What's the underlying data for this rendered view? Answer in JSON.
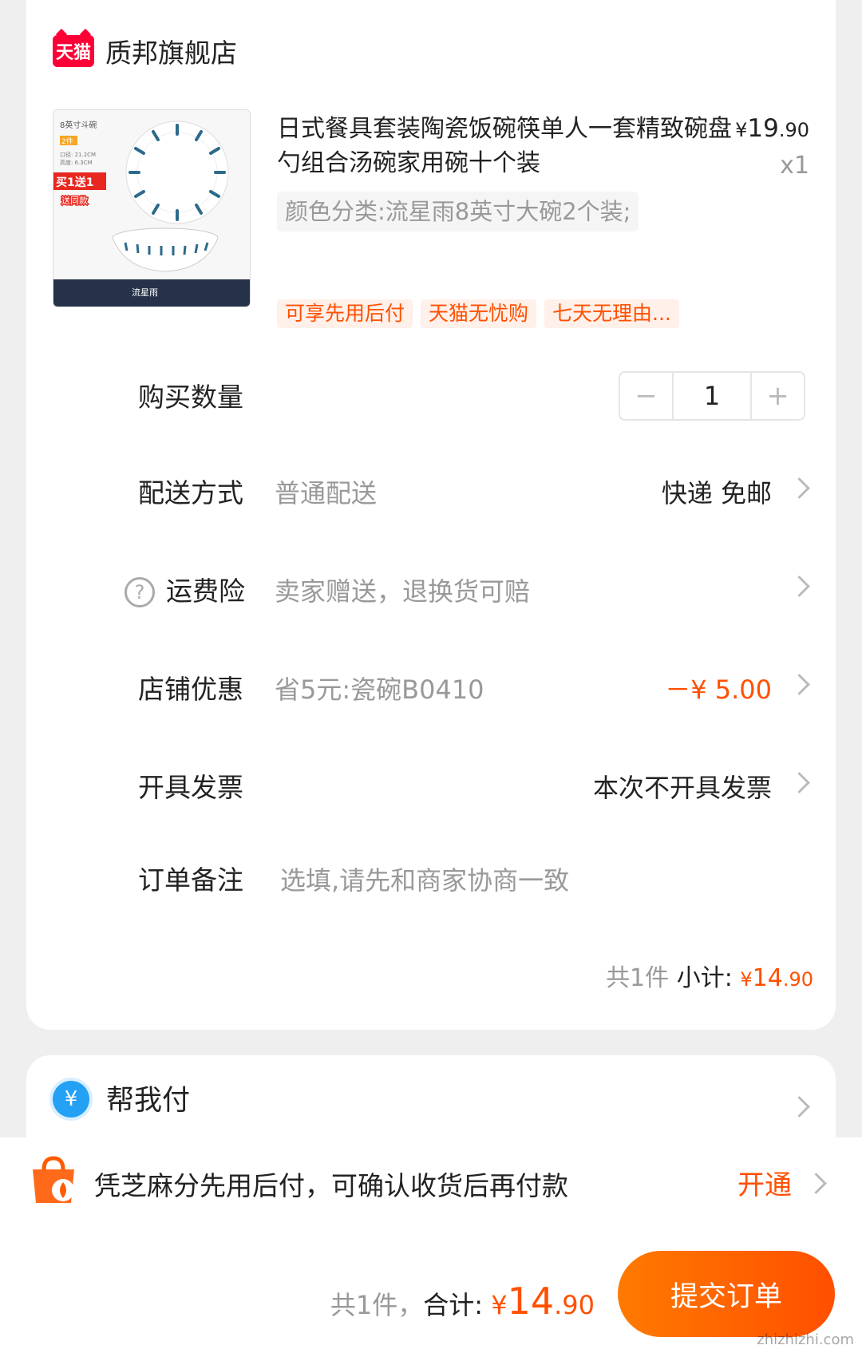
{
  "shop": {
    "name": "质邦旗舰店",
    "logo_text": "天猫"
  },
  "product": {
    "title": "日式餐具套装陶瓷饭碗筷单人一套精致碗盘勺组合汤碗家用碗十个装",
    "price_currency": "¥",
    "price_int": "19",
    "price_dec": ".90",
    "quantity": "x1",
    "sku": "颜色分类:流星雨8英寸大碗2个装;",
    "image": {
      "size_label": "8英寸斗碗",
      "pieces": "2件",
      "spec1": "口径: 21.2CM",
      "spec2": "高度: 6.3CM",
      "promo": "买1送1",
      "promo_sub": "送同款",
      "pattern_name": "流星雨"
    },
    "tags": [
      "可享先用后付",
      "天猫无忧购",
      "七天无理由..."
    ]
  },
  "rows": {
    "quantity": {
      "label": "购买数量",
      "minus": "−",
      "value": "1",
      "plus": "+"
    },
    "delivery": {
      "label": "配送方式",
      "value": "普通配送",
      "right": "快递 免邮"
    },
    "shipping_insurance": {
      "label": "运费险",
      "value": "卖家赠送，退换货可赔",
      "help_icon": "?"
    },
    "shop_discount": {
      "label": "店铺优惠",
      "value": "省5元:瓷碗B0410",
      "right": "－¥ 5.00"
    },
    "invoice": {
      "label": "开具发票",
      "right": "本次不开具发票"
    },
    "note": {
      "label": "订单备注",
      "placeholder": "选填,请先和商家协商一致"
    }
  },
  "subtotal": {
    "count": "共1件",
    "label": "小计:",
    "currency": "¥",
    "int": "14",
    "dec": ".90"
  },
  "help_pay": {
    "label": "帮我付",
    "icon": "¥"
  },
  "pay_later": {
    "text": "凭芝麻分先用后付，可确认收货后再付款",
    "action": "开通"
  },
  "footer": {
    "count": "共1件，",
    "label": "合计:",
    "currency": "¥",
    "int": "14",
    "dec": ".90",
    "submit": "提交订单"
  },
  "watermark": "zhizhizhi.com",
  "colors": {
    "accent": "#ff5000",
    "tmall_red": "#ff0036",
    "help_pay_blue": "#24a0f5"
  }
}
